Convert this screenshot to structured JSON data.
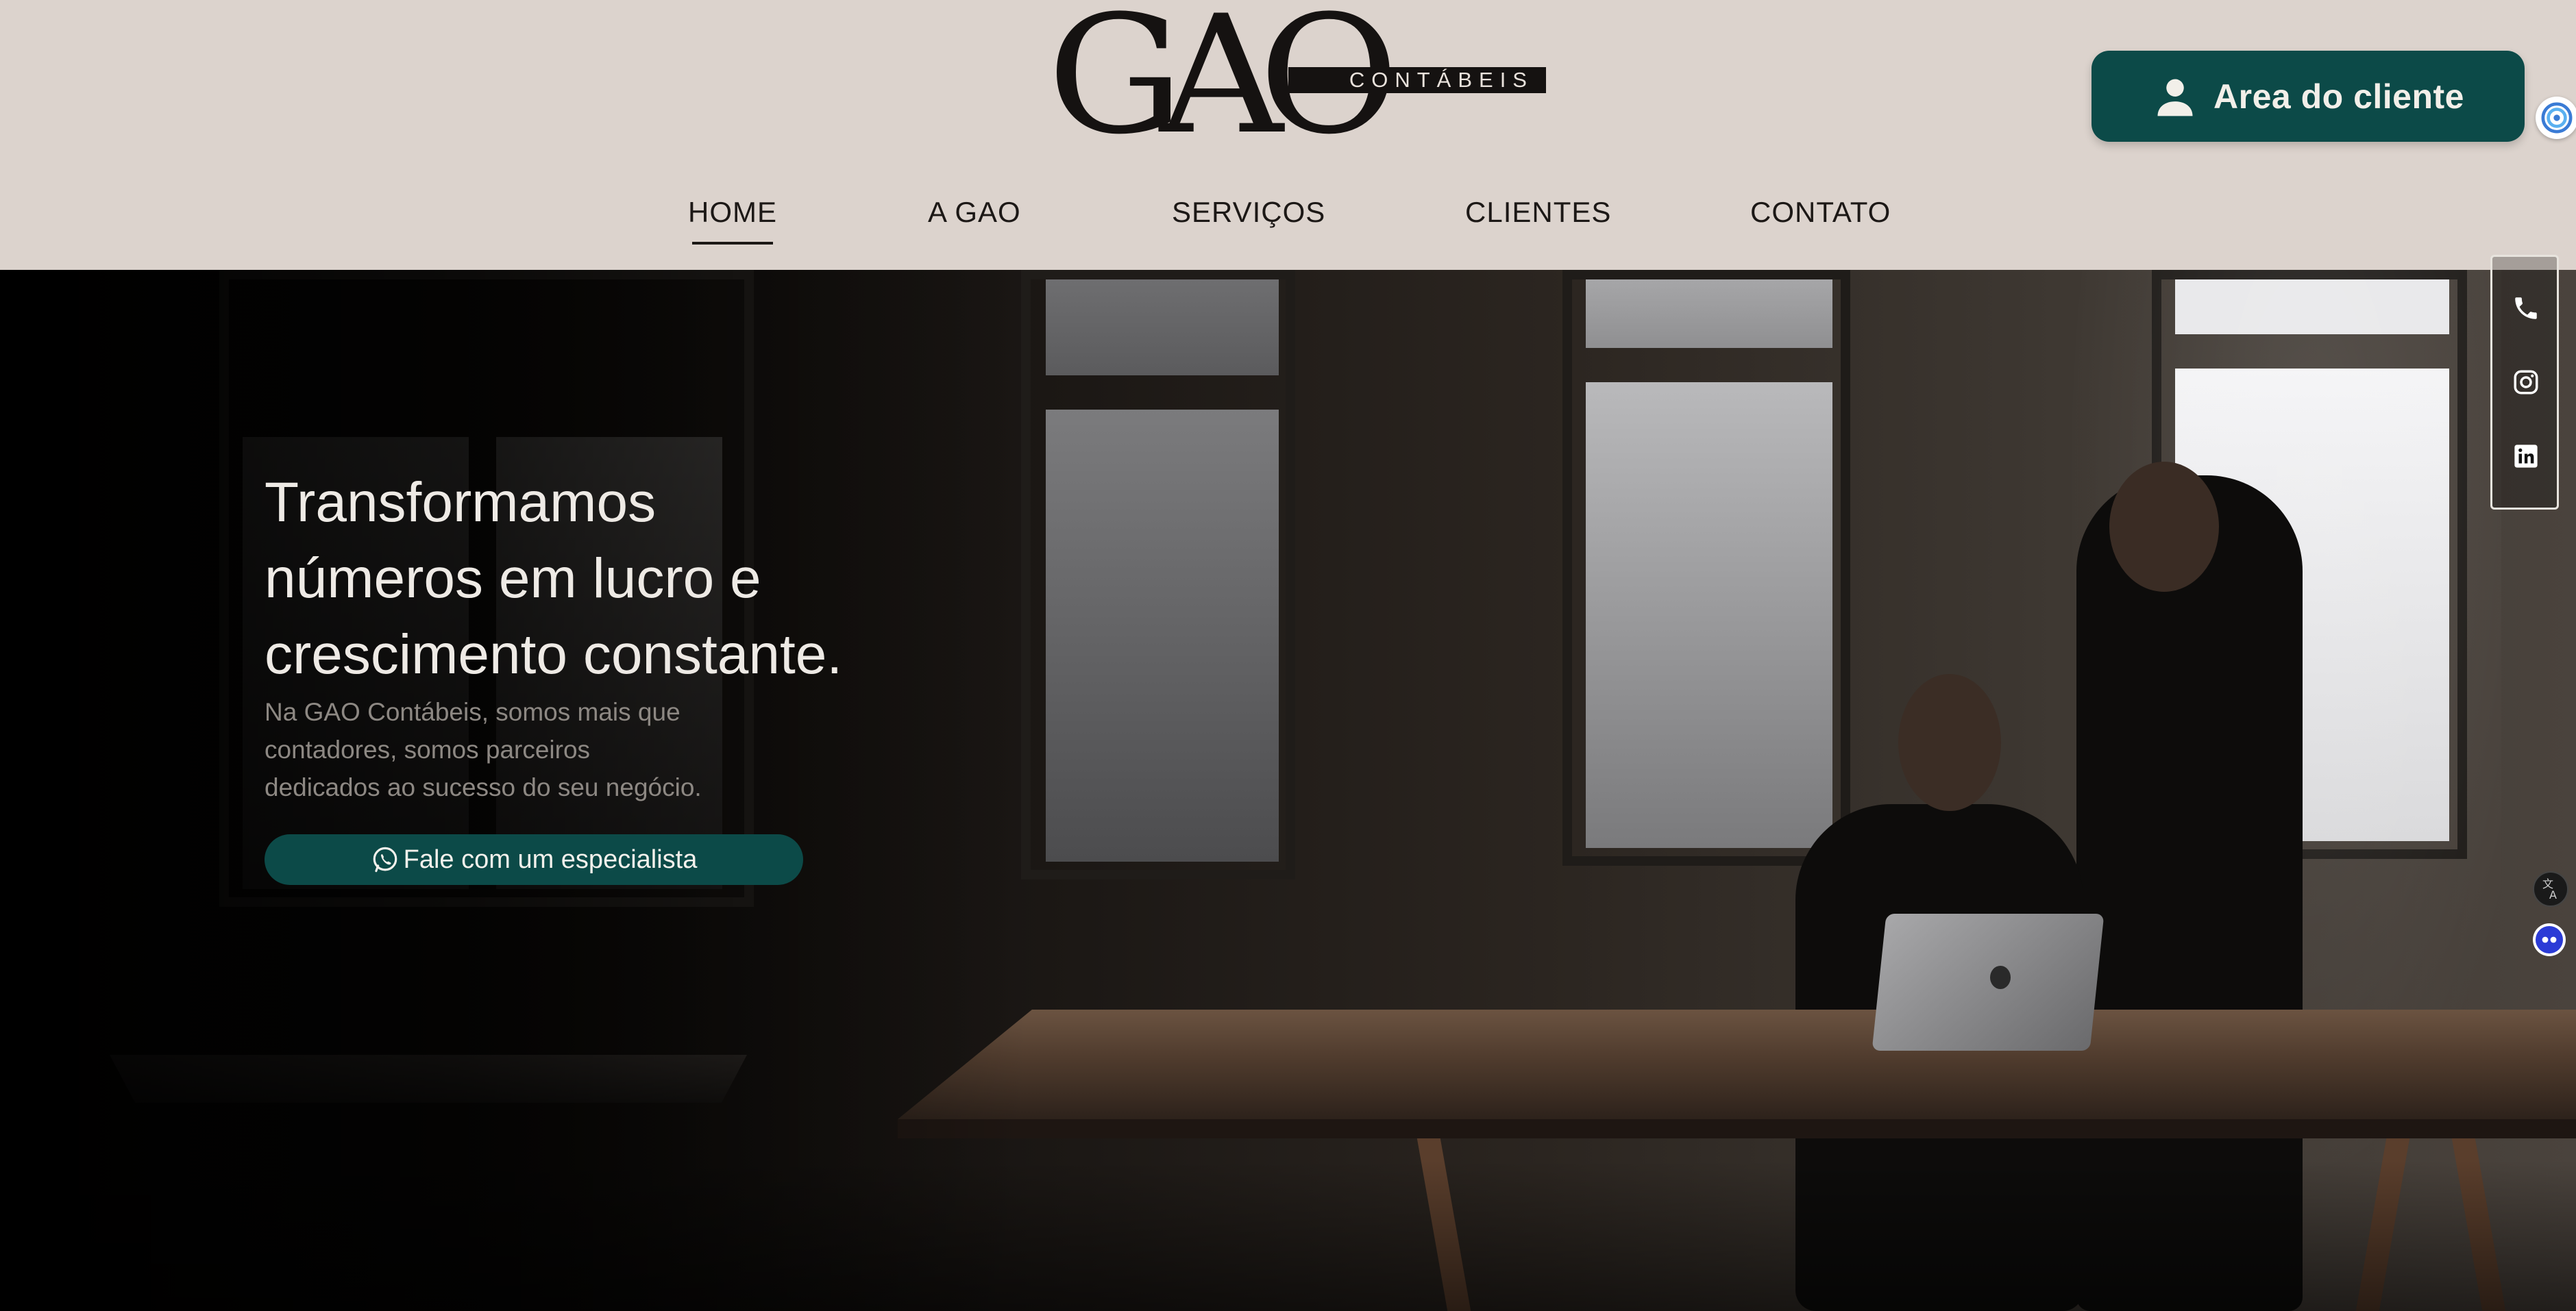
{
  "brand": {
    "logo_word": "GAO",
    "logo_tag": "CONTÁBEIS"
  },
  "header": {
    "client_area_label": "Area do cliente",
    "client_area_icon": "user-icon"
  },
  "nav": {
    "items": [
      {
        "label": "HOME",
        "active": true
      },
      {
        "label": "A GAO",
        "active": false
      },
      {
        "label": "SERVIÇOS",
        "active": false
      },
      {
        "label": "CLIENTES",
        "active": false
      },
      {
        "label": "CONTATO",
        "active": false
      }
    ]
  },
  "hero": {
    "title_lines": [
      "Transformamos",
      "números em lucro e",
      "crescimento constante."
    ],
    "subtitle_lines": [
      "Na GAO Contábeis, somos mais que",
      "contadores, somos parceiros",
      "dedicados ao sucesso do seu negócio."
    ],
    "cta_label": "Fale com um especialista",
    "cta_icon": "whatsapp-icon"
  },
  "social": {
    "icons": [
      "phone-icon",
      "instagram-icon",
      "linkedin-icon"
    ]
  },
  "floating": {
    "icons": [
      "swirl-icon",
      "translate-icon",
      "accessibility-icon"
    ]
  },
  "colors": {
    "accent": "#0c4a48",
    "header_bg": "#dcd3cd",
    "text_dark": "#1c1816",
    "hero_text": "#eeeae5"
  }
}
